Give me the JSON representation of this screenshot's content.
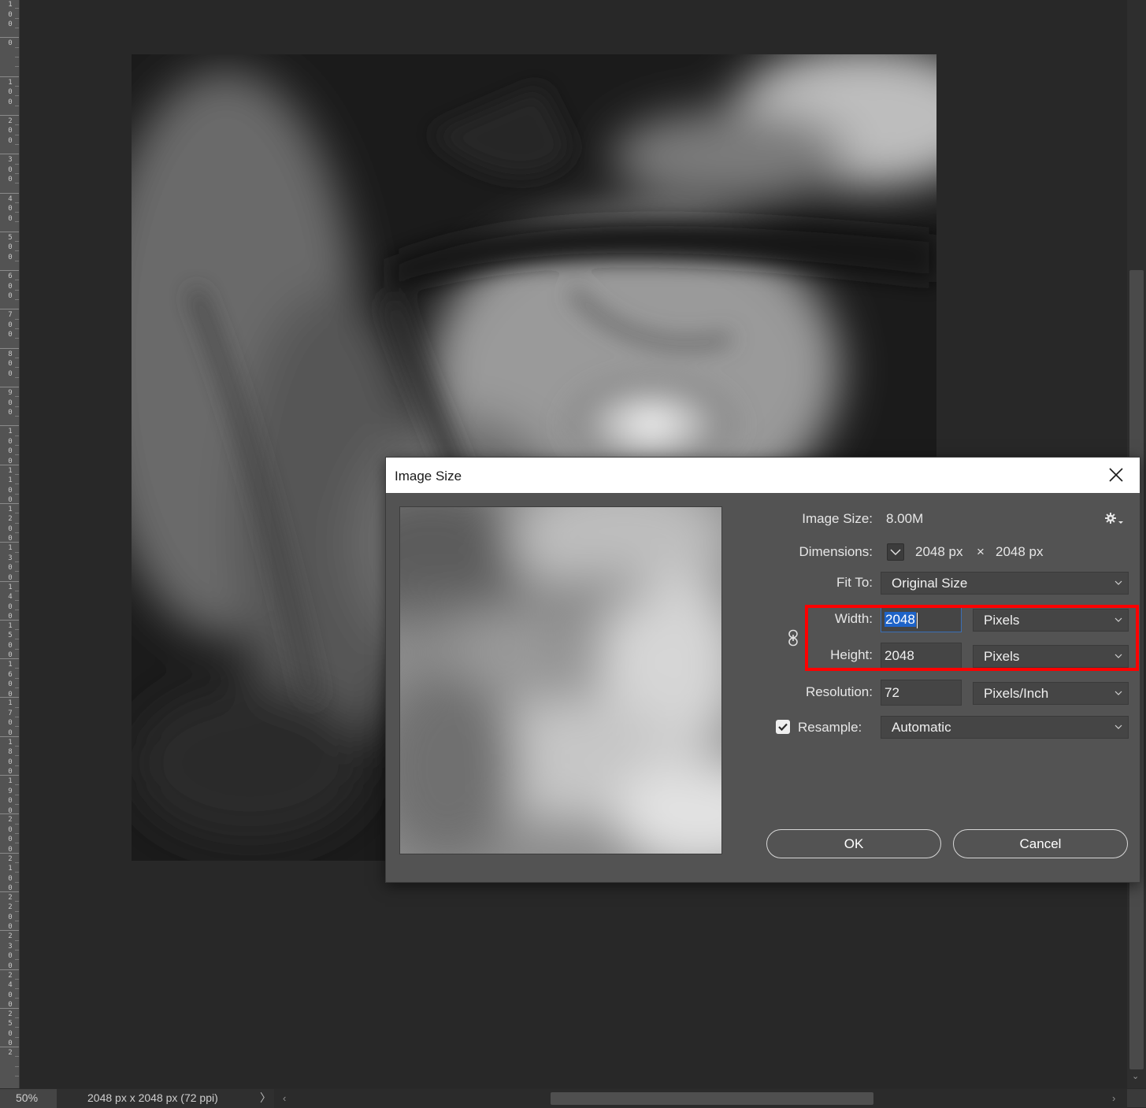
{
  "ruler": {
    "labels": [
      "100",
      "0",
      "100",
      "200",
      "300",
      "400",
      "500",
      "600",
      "700",
      "800",
      "900",
      "1000",
      "1100",
      "1200",
      "1300",
      "1400",
      "1500",
      "1600",
      "1700",
      "1800",
      "1900",
      "2000",
      "2100",
      "2200",
      "2300",
      "2400",
      "2500",
      "2"
    ]
  },
  "status": {
    "zoom": "50%",
    "doc_info": "2048 px x 2048 px (72 ppi)",
    "chevron": "〉"
  },
  "dialog": {
    "title": "Image Size",
    "image_size_label": "Image Size:",
    "image_size_value": "8.00M",
    "dimensions_label": "Dimensions:",
    "dim_width": "2048 px",
    "dim_times": "×",
    "dim_height": "2048 px",
    "fit_to_label": "Fit To:",
    "fit_to_value": "Original Size",
    "width_label": "Width:",
    "width_value": "2048",
    "width_unit": "Pixels",
    "height_label": "Height:",
    "height_value": "2048",
    "height_unit": "Pixels",
    "resolution_label": "Resolution:",
    "resolution_value": "72",
    "resolution_unit": "Pixels/Inch",
    "resample_label": "Resample:",
    "resample_checked": true,
    "resample_value": "Automatic",
    "ok_label": "OK",
    "cancel_label": "Cancel"
  },
  "icons": {
    "close": "close-icon",
    "gear": "gear-icon",
    "link": "chain-link-icon",
    "dimensions_toggle": "chevron-down-icon",
    "checkbox": "checkmark-icon"
  },
  "colors": {
    "highlight": "#ff0000",
    "selection": "#1e63c8",
    "dialog_bg": "#535353"
  }
}
